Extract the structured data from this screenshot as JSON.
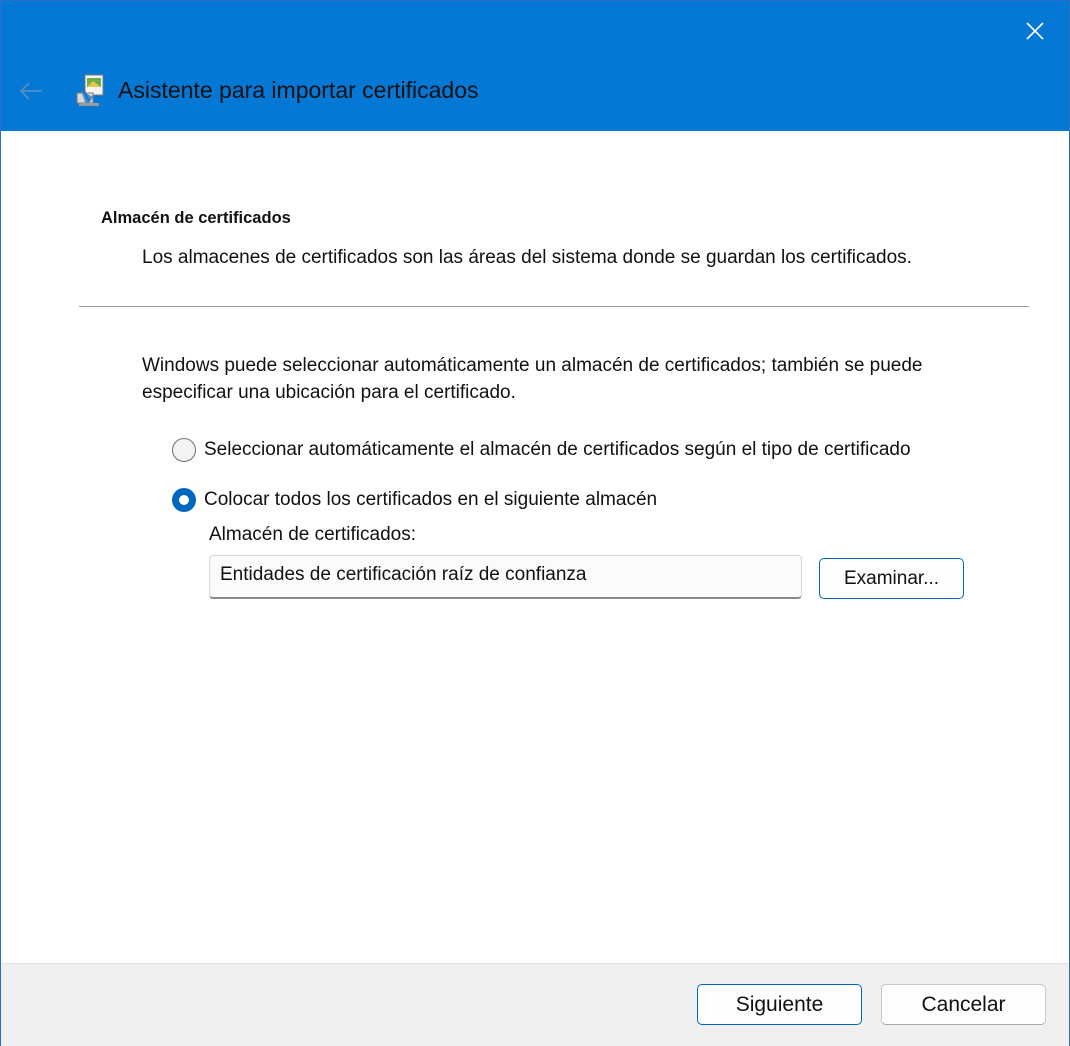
{
  "window": {
    "title": "Asistente para importar certificados",
    "accent_color": "#0478d4",
    "icons": {
      "back": "arrow-left-icon",
      "app": "certificate-wizard-icon",
      "close": "close-icon"
    }
  },
  "page": {
    "heading": "Almacén de certificados",
    "description": "Los almacenes de certificados son las áreas del sistema donde se guardan los certificados.",
    "intro": "Windows puede seleccionar automáticamente un almacén de certificados; también se puede especificar una ubicación para el certificado.",
    "options": [
      {
        "label": "Seleccionar automáticamente el almacén de certificados según el tipo de certificado",
        "selected": false
      },
      {
        "label": "Colocar todos los certificados en el siguiente almacén",
        "selected": true
      }
    ],
    "store_label": "Almacén de certificados:",
    "store_value": "Entidades de certificación raíz de confianza",
    "browse_label": "Examinar..."
  },
  "footer": {
    "next_label": "Siguiente",
    "cancel_label": "Cancelar"
  }
}
